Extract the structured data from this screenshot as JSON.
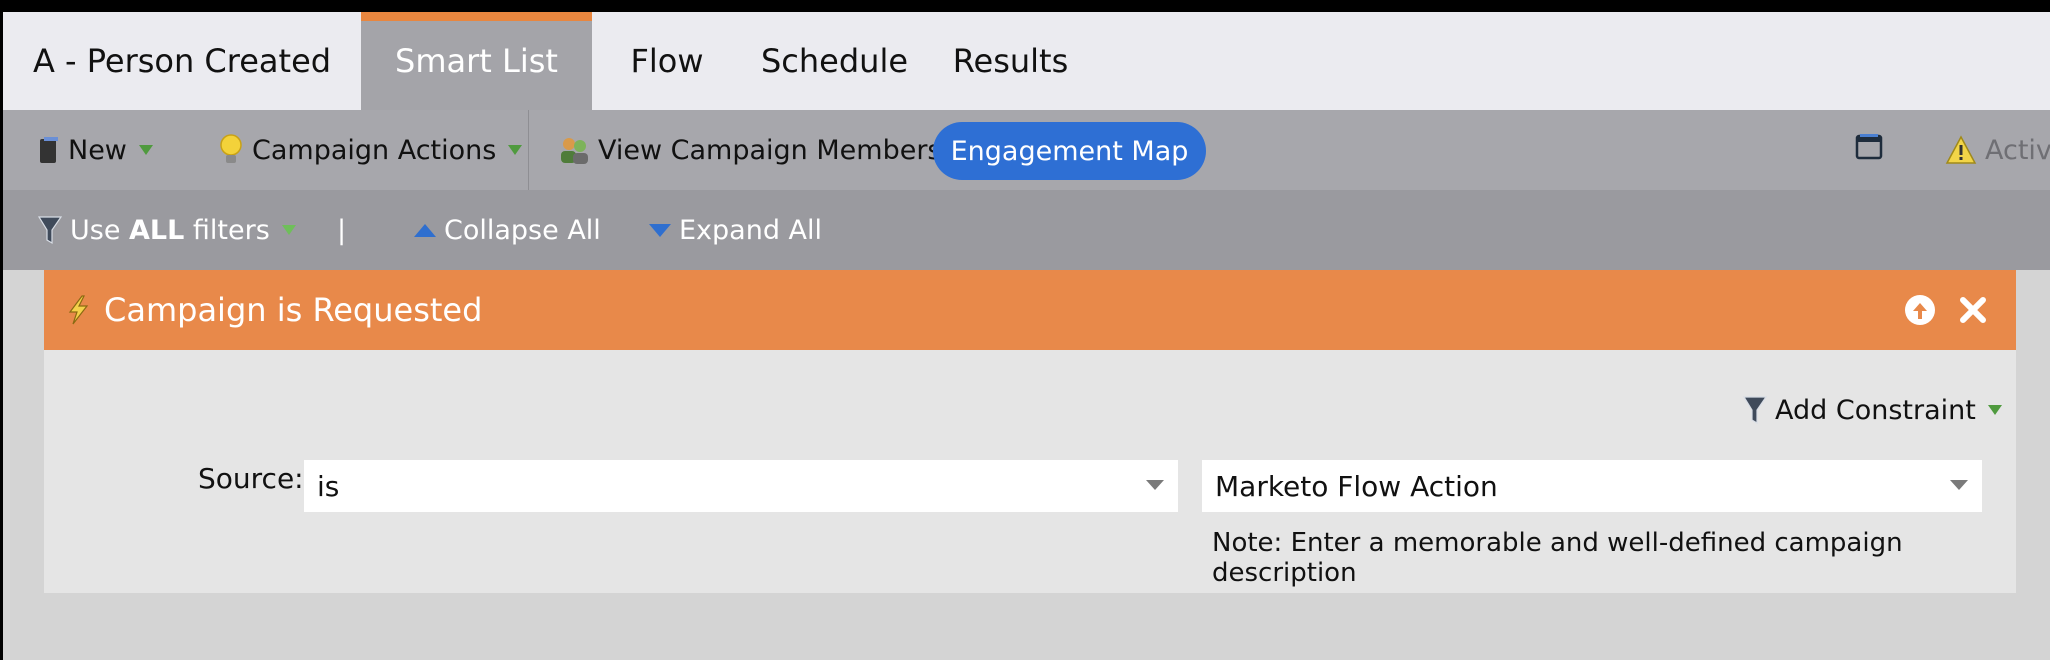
{
  "tabs": [
    {
      "label": "A - Person Created",
      "active": false
    },
    {
      "label": "Smart List",
      "active": true
    },
    {
      "label": "Flow",
      "active": false
    },
    {
      "label": "Schedule",
      "active": false
    },
    {
      "label": "Results",
      "active": false
    }
  ],
  "toolbar": {
    "new_label": "New",
    "campaign_actions_label": "Campaign Actions",
    "view_members_label": "View Campaign Members",
    "engagement_map_label": "Engagement Map",
    "status_label": "Active"
  },
  "filterbar": {
    "use_prefix": "Use ",
    "use_bold": "ALL",
    "use_suffix": " filters",
    "separator": "|",
    "collapse_label": "Collapse All",
    "expand_label": "Expand All"
  },
  "filter": {
    "title": "Campaign is Requested",
    "add_constraint_label": "Add Constraint",
    "source_label": "Source:",
    "operator_value": "is",
    "source_value": "Marketo Flow Action",
    "note": "Note: Enter a memorable and well-defined campaign description"
  },
  "colors": {
    "accent_orange": "#e8863f",
    "primary_blue": "#2e6fd4"
  }
}
